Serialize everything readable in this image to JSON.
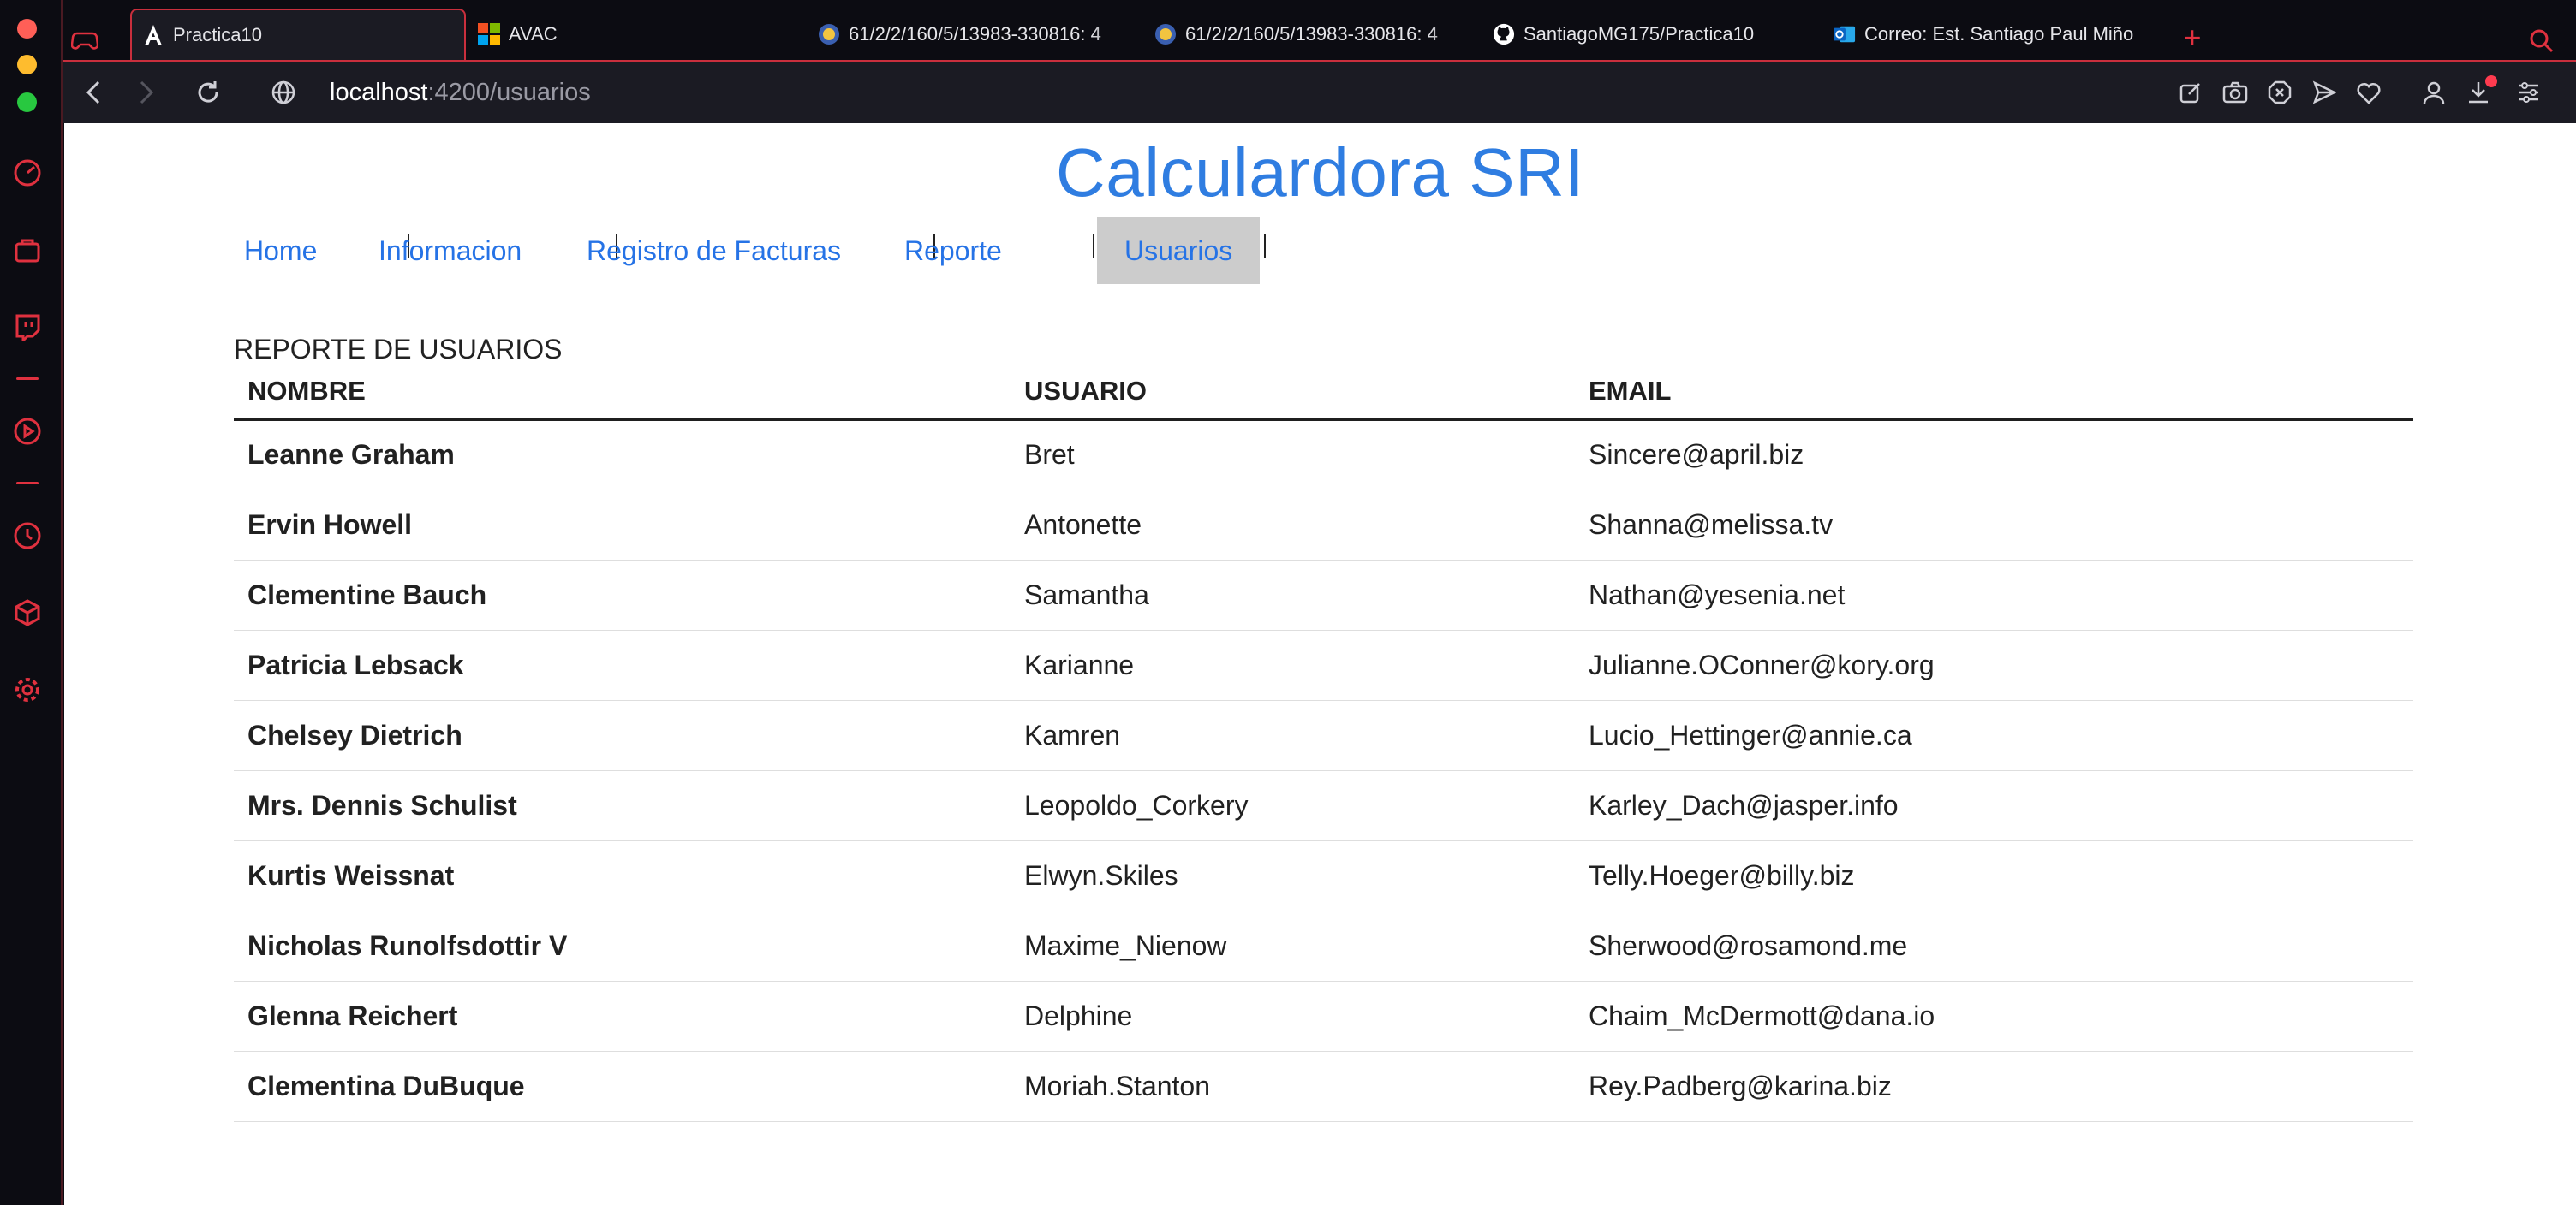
{
  "browser": {
    "tabs": [
      {
        "label": "Practica10",
        "icon": "angular-icon",
        "active": true
      },
      {
        "label": "AVAC",
        "icon": "microsoft-icon",
        "active": false
      },
      {
        "label": "61/2/2/160/5/13983-330816: 4",
        "icon": "university-icon",
        "active": false
      },
      {
        "label": "61/2/2/160/5/13983-330816: 4",
        "icon": "university-icon",
        "active": false
      },
      {
        "label": "SantiagoMG175/Practica10",
        "icon": "github-icon",
        "active": false
      },
      {
        "label": "Correo: Est. Santiago Paul Miño",
        "icon": "outlook-icon",
        "active": false
      }
    ],
    "url_host": "localhost",
    "url_path": ":4200/usuarios",
    "accent": "#c92f3d"
  },
  "page": {
    "title": "Calculardora SRI",
    "nav": [
      {
        "label": "Home",
        "active": false
      },
      {
        "label": "Informacion",
        "active": false
      },
      {
        "label": "Registro de Facturas",
        "active": false
      },
      {
        "label": "Reporte",
        "active": false
      },
      {
        "label": "Usuarios",
        "active": true
      }
    ],
    "section_label": "REPORTE DE USUARIOS",
    "table": {
      "headers": [
        "NOMBRE",
        "USUARIO",
        "EMAIL"
      ],
      "rows": [
        [
          "Leanne Graham",
          "Bret",
          "Sincere@april.biz"
        ],
        [
          "Ervin Howell",
          "Antonette",
          "Shanna@melissa.tv"
        ],
        [
          "Clementine Bauch",
          "Samantha",
          "Nathan@yesenia.net"
        ],
        [
          "Patricia Lebsack",
          "Karianne",
          "Julianne.OConner@kory.org"
        ],
        [
          "Chelsey Dietrich",
          "Kamren",
          "Lucio_Hettinger@annie.ca"
        ],
        [
          "Mrs. Dennis Schulist",
          "Leopoldo_Corkery",
          "Karley_Dach@jasper.info"
        ],
        [
          "Kurtis Weissnat",
          "Elwyn.Skiles",
          "Telly.Hoeger@billy.biz"
        ],
        [
          "Nicholas Runolfsdottir V",
          "Maxime_Nienow",
          "Sherwood@rosamond.me"
        ],
        [
          "Glenna Reichert",
          "Delphine",
          "Chaim_McDermott@dana.io"
        ],
        [
          "Clementina DuBuque",
          "Moriah.Stanton",
          "Rey.Padberg@karina.biz"
        ]
      ]
    },
    "colors": {
      "title": "#2f7de1",
      "link": "#2673e6",
      "active_nav_bg": "#cccccc"
    }
  }
}
